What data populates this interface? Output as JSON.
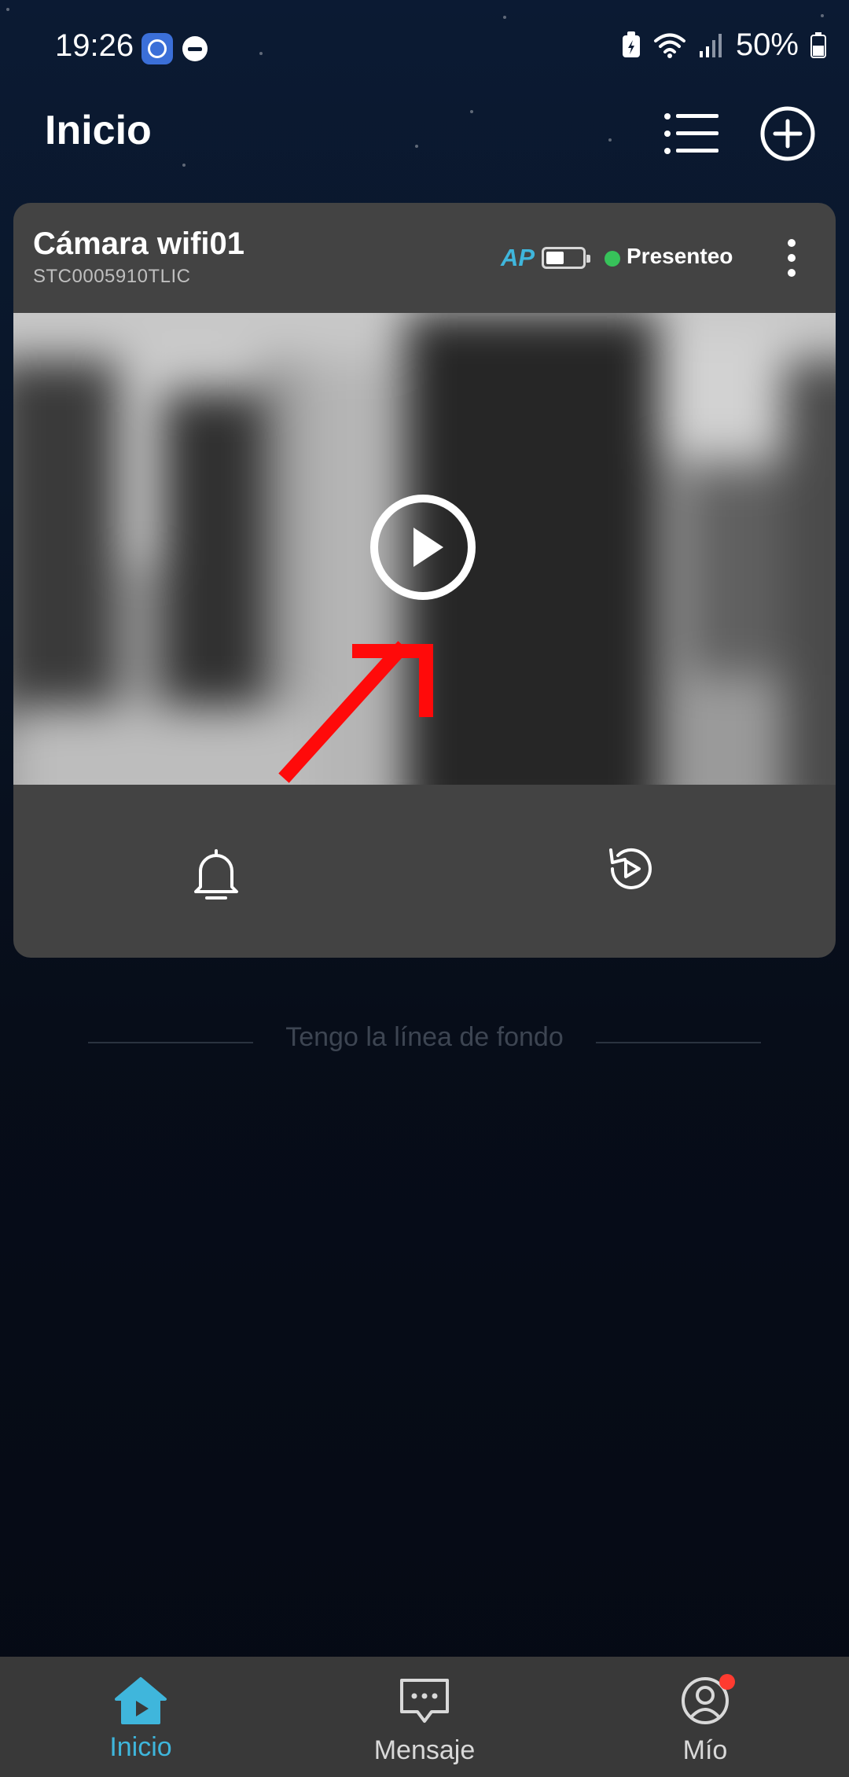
{
  "status_bar": {
    "time": "19:26",
    "battery_percent": "50%"
  },
  "header": {
    "title": "Inicio",
    "icons": [
      "list-menu-icon",
      "add-circle-icon"
    ]
  },
  "device_card": {
    "name": "Cámara wifi01",
    "serial": "STC0005910TLIC",
    "connection_mode": "AP",
    "battery_level": 0.5,
    "status": "Presenteo",
    "status_color": "#37c25a",
    "accent_color": "#3fb6dc",
    "icons": [
      "more-vertical-icon",
      "play-icon",
      "bell-icon",
      "playback-history-icon"
    ]
  },
  "footer_divider": {
    "text": "Tengo la línea de fondo"
  },
  "bottom_nav": {
    "items": [
      {
        "label": "Inicio",
        "icon": "home-play-icon",
        "active": true,
        "active_color": "#3fb6dc"
      },
      {
        "label": "Mensaje",
        "icon": "message-icon",
        "active": false
      },
      {
        "label": "Mío",
        "icon": "profile-icon",
        "active": false,
        "badge": true
      }
    ]
  }
}
